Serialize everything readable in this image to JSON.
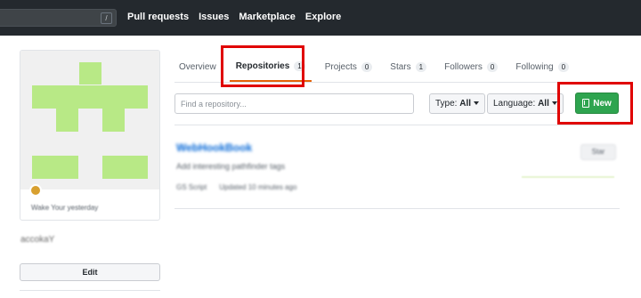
{
  "header": {
    "search_shortcut": "/",
    "nav": [
      "Pull requests",
      "Issues",
      "Marketplace",
      "Explore"
    ]
  },
  "profile": {
    "status_text": "Wake Your yesterday",
    "username": "accokaY",
    "edit_label": "Edit"
  },
  "tabs": [
    {
      "label": "Overview",
      "count": null
    },
    {
      "label": "Repositories",
      "count": "1",
      "selected": true
    },
    {
      "label": "Projects",
      "count": "0"
    },
    {
      "label": "Stars",
      "count": "1"
    },
    {
      "label": "Followers",
      "count": "0"
    },
    {
      "label": "Following",
      "count": "0"
    }
  ],
  "filters": {
    "search_placeholder": "Find a repository...",
    "type_label": "Type:",
    "type_value": "All",
    "language_label": "Language:",
    "language_value": "All",
    "new_label": "New"
  },
  "repo": {
    "name": "WebHookBook",
    "description": "Add interesting pathfinder tags",
    "language": "GS Script",
    "updated": "Updated 10 minutes ago",
    "star_label": "Star"
  },
  "colors": {
    "header_bg": "#24292e",
    "new_button": "#2ea44f",
    "selected_tab_underline": "#e36209",
    "link": "#0366d6",
    "highlight": "#e00000",
    "avatar_pattern": "#b8e986"
  }
}
